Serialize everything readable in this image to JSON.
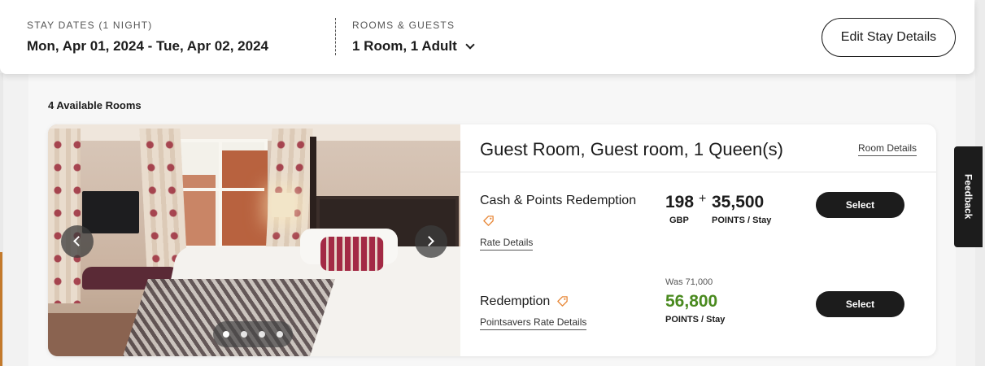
{
  "header": {
    "dates_label": "STAY DATES (1 NIGHT)",
    "dates_value": "Mon, Apr 01, 2024 - Tue, Apr 02, 2024",
    "rooms_label": "ROOMS & GUESTS",
    "rooms_value": "1 Room, 1 Adult",
    "edit_button": "Edit Stay Details"
  },
  "results": {
    "available_count": "4 Available Rooms"
  },
  "room": {
    "title": "Guest Room, Guest room, 1 Queen(s)",
    "details_link": "Room Details",
    "carousel": {
      "total_images": 4,
      "active_index": 0
    },
    "rates": [
      {
        "name": "Cash & Points Redemption",
        "link": "Rate Details",
        "cash_amount": "198",
        "cash_currency": "GBP",
        "plus": "+",
        "points_amount": "35,500",
        "points_unit": "POINTS / Stay",
        "select_label": "Select"
      },
      {
        "name": "Redemption",
        "link": "Pointsavers Rate Details",
        "was_label": "Was 71,000",
        "points_amount": "56,800",
        "points_unit": "POINTS / Stay",
        "select_label": "Select"
      }
    ]
  },
  "feedback_tab": "Feedback",
  "colors": {
    "accent_green": "#4a8a1f",
    "tag_orange": "#e8893a",
    "button_dark": "#1c1c1c"
  },
  "icons": {
    "dropdown": "chevron-down-icon",
    "tag": "tag-icon",
    "carousel_prev": "chevron-left-icon",
    "carousel_next": "chevron-right-icon"
  }
}
